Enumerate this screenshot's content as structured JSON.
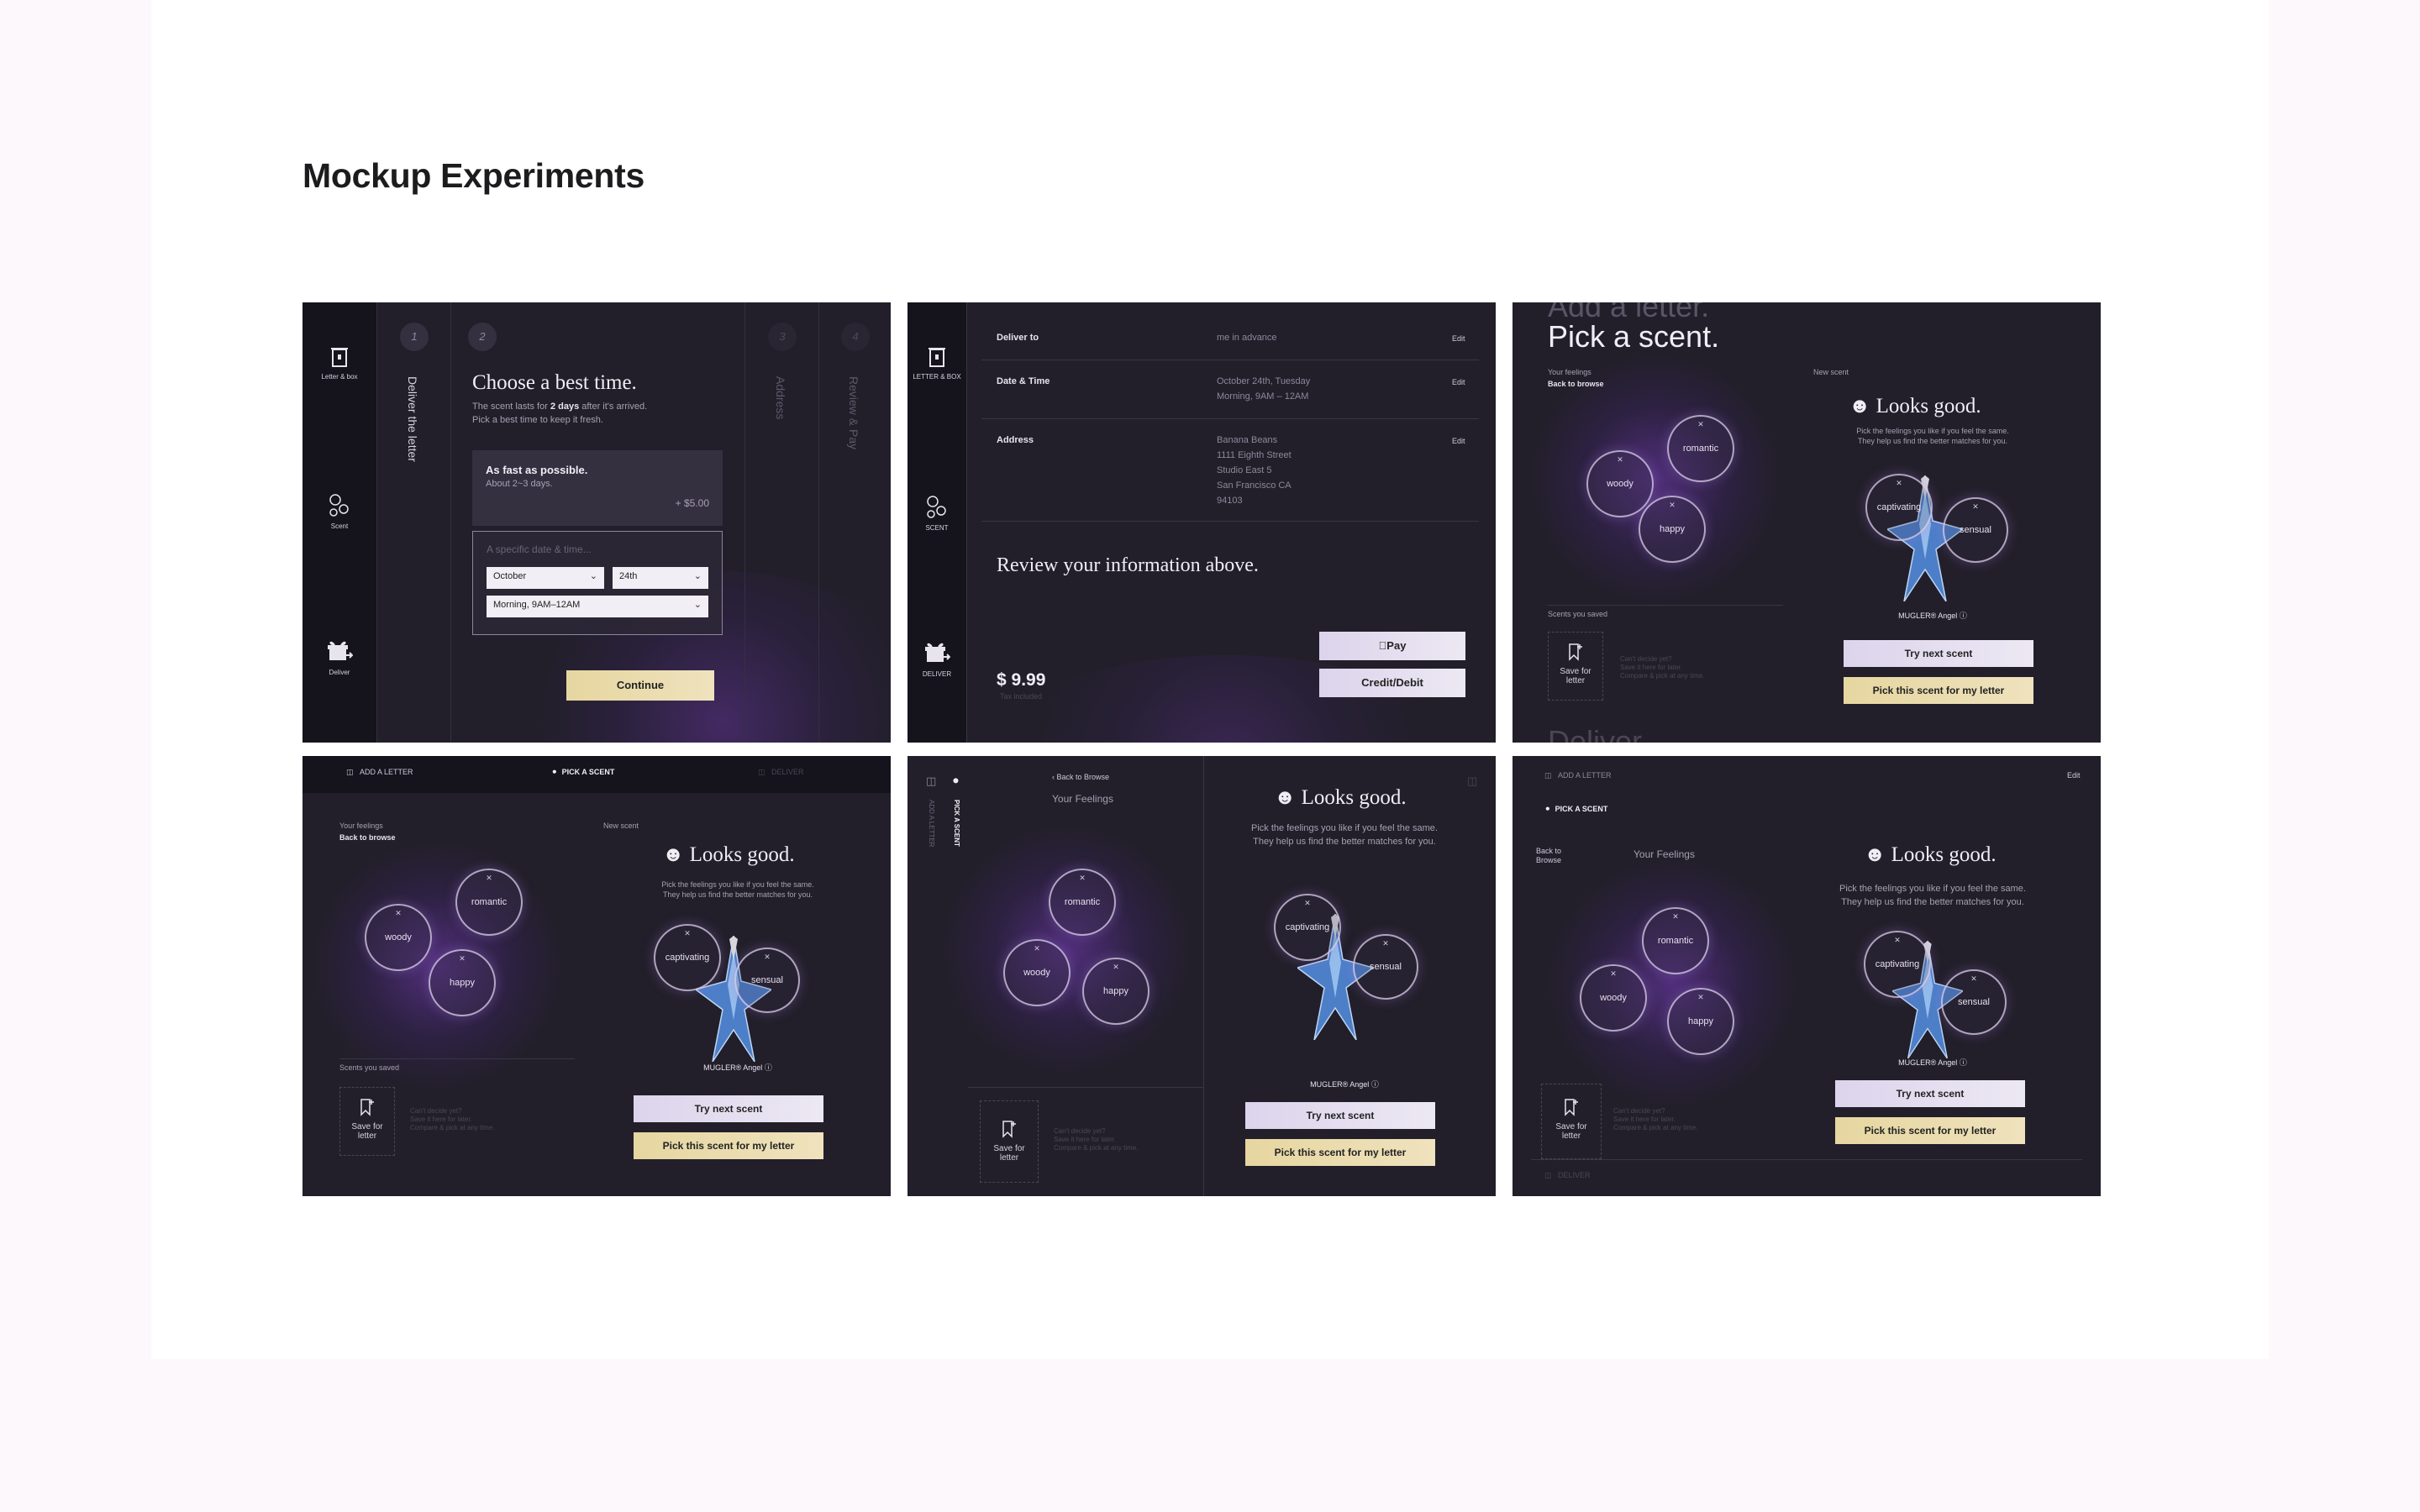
{
  "page": {
    "title": "Mockup Experiments"
  },
  "m1": {
    "rail": {
      "letter": "Letter & box",
      "scent": "Scent",
      "deliver": "Deliver"
    },
    "steps": {
      "n1": "1",
      "n2": "2",
      "n3": "3",
      "n4": "4",
      "deliver": "Deliver the letter",
      "address": "Address",
      "review": "Review & Pay"
    },
    "heading": "Choose a best time.",
    "sub1_pre": "The scent lasts for ",
    "sub1_bold": "2 days",
    "sub1_post": " after it's arrived.",
    "sub2": "Pick a best time to keep it fresh.",
    "fast": {
      "title": "As fast as possible.",
      "sub": "About 2~3 days.",
      "price": "+ $5.00"
    },
    "specific": {
      "label": "A specific date & time...",
      "month": "October",
      "day": "24th",
      "slot": "Morning, 9AM–12AM"
    },
    "continue": "Continue"
  },
  "m2": {
    "rail": {
      "letter": "LETTER & BOX",
      "scent": "SCENT",
      "deliver": "DELIVER"
    },
    "rows": [
      {
        "label": "Deliver to",
        "value": "me in advance",
        "edit": "Edit"
      },
      {
        "label": "Date & Time",
        "value1": "October 24th, Tuesday",
        "value2": "Morning, 9AM – 12AM",
        "edit": "Edit"
      },
      {
        "label": "Address",
        "lines": [
          "Banana Beans",
          "1111 Eighth Street",
          "Studio East 5",
          "San Francisco CA",
          "94103"
        ],
        "edit": "Edit"
      }
    ],
    "review": "Review your information above.",
    "price": "$ 9.99",
    "tax": "Tax included",
    "applepay": "Pay",
    "card": "Credit/Debit"
  },
  "m3": {
    "top_ghost": "Add a letter.",
    "heading": "Pick a scent.",
    "your_feelings": "Your feelings",
    "back": "Back to browse",
    "new_scent": "New scent",
    "scents_saved": "Scents you saved",
    "bottom_ghost": "Deliver"
  },
  "scent": {
    "looks_good": "Looks good.",
    "desc1": "Pick the feelings you like if you feel the same.",
    "desc2": "They help us find the better matches for you.",
    "product": "MUGLER® Angel",
    "try_next": "Try next scent",
    "pick": "Pick this scent for my letter",
    "save": "Save for letter",
    "save_hint1": "Can't decide yet?",
    "save_hint2": "Save it here for later.",
    "save_hint3": "Compare & pick at any time.",
    "tags": {
      "romantic": "romantic",
      "woody": "woody",
      "happy": "happy",
      "captivating": "captivating",
      "sensual": "sensual"
    }
  },
  "m4": {
    "nav": {
      "letter": "ADD A LETTER",
      "scent": "PICK A SCENT",
      "deliver": "DELIVER"
    },
    "your_feelings": "Your feelings",
    "back": "Back to browse",
    "new_scent": "New scent",
    "scents_saved": "Scents you saved"
  },
  "m5": {
    "rail": {
      "letter": "ADD A LETTER",
      "scent": "PICK A SCENT"
    },
    "back": "Back to Browse",
    "your_feelings": "Your Feelings"
  },
  "m6": {
    "nav": {
      "letter": "ADD A LETTER",
      "scent": "PICK A SCENT",
      "deliver": "DELIVER",
      "edit": "Edit"
    },
    "back": "Back to Browse",
    "your_feelings": "Your Feelings"
  }
}
